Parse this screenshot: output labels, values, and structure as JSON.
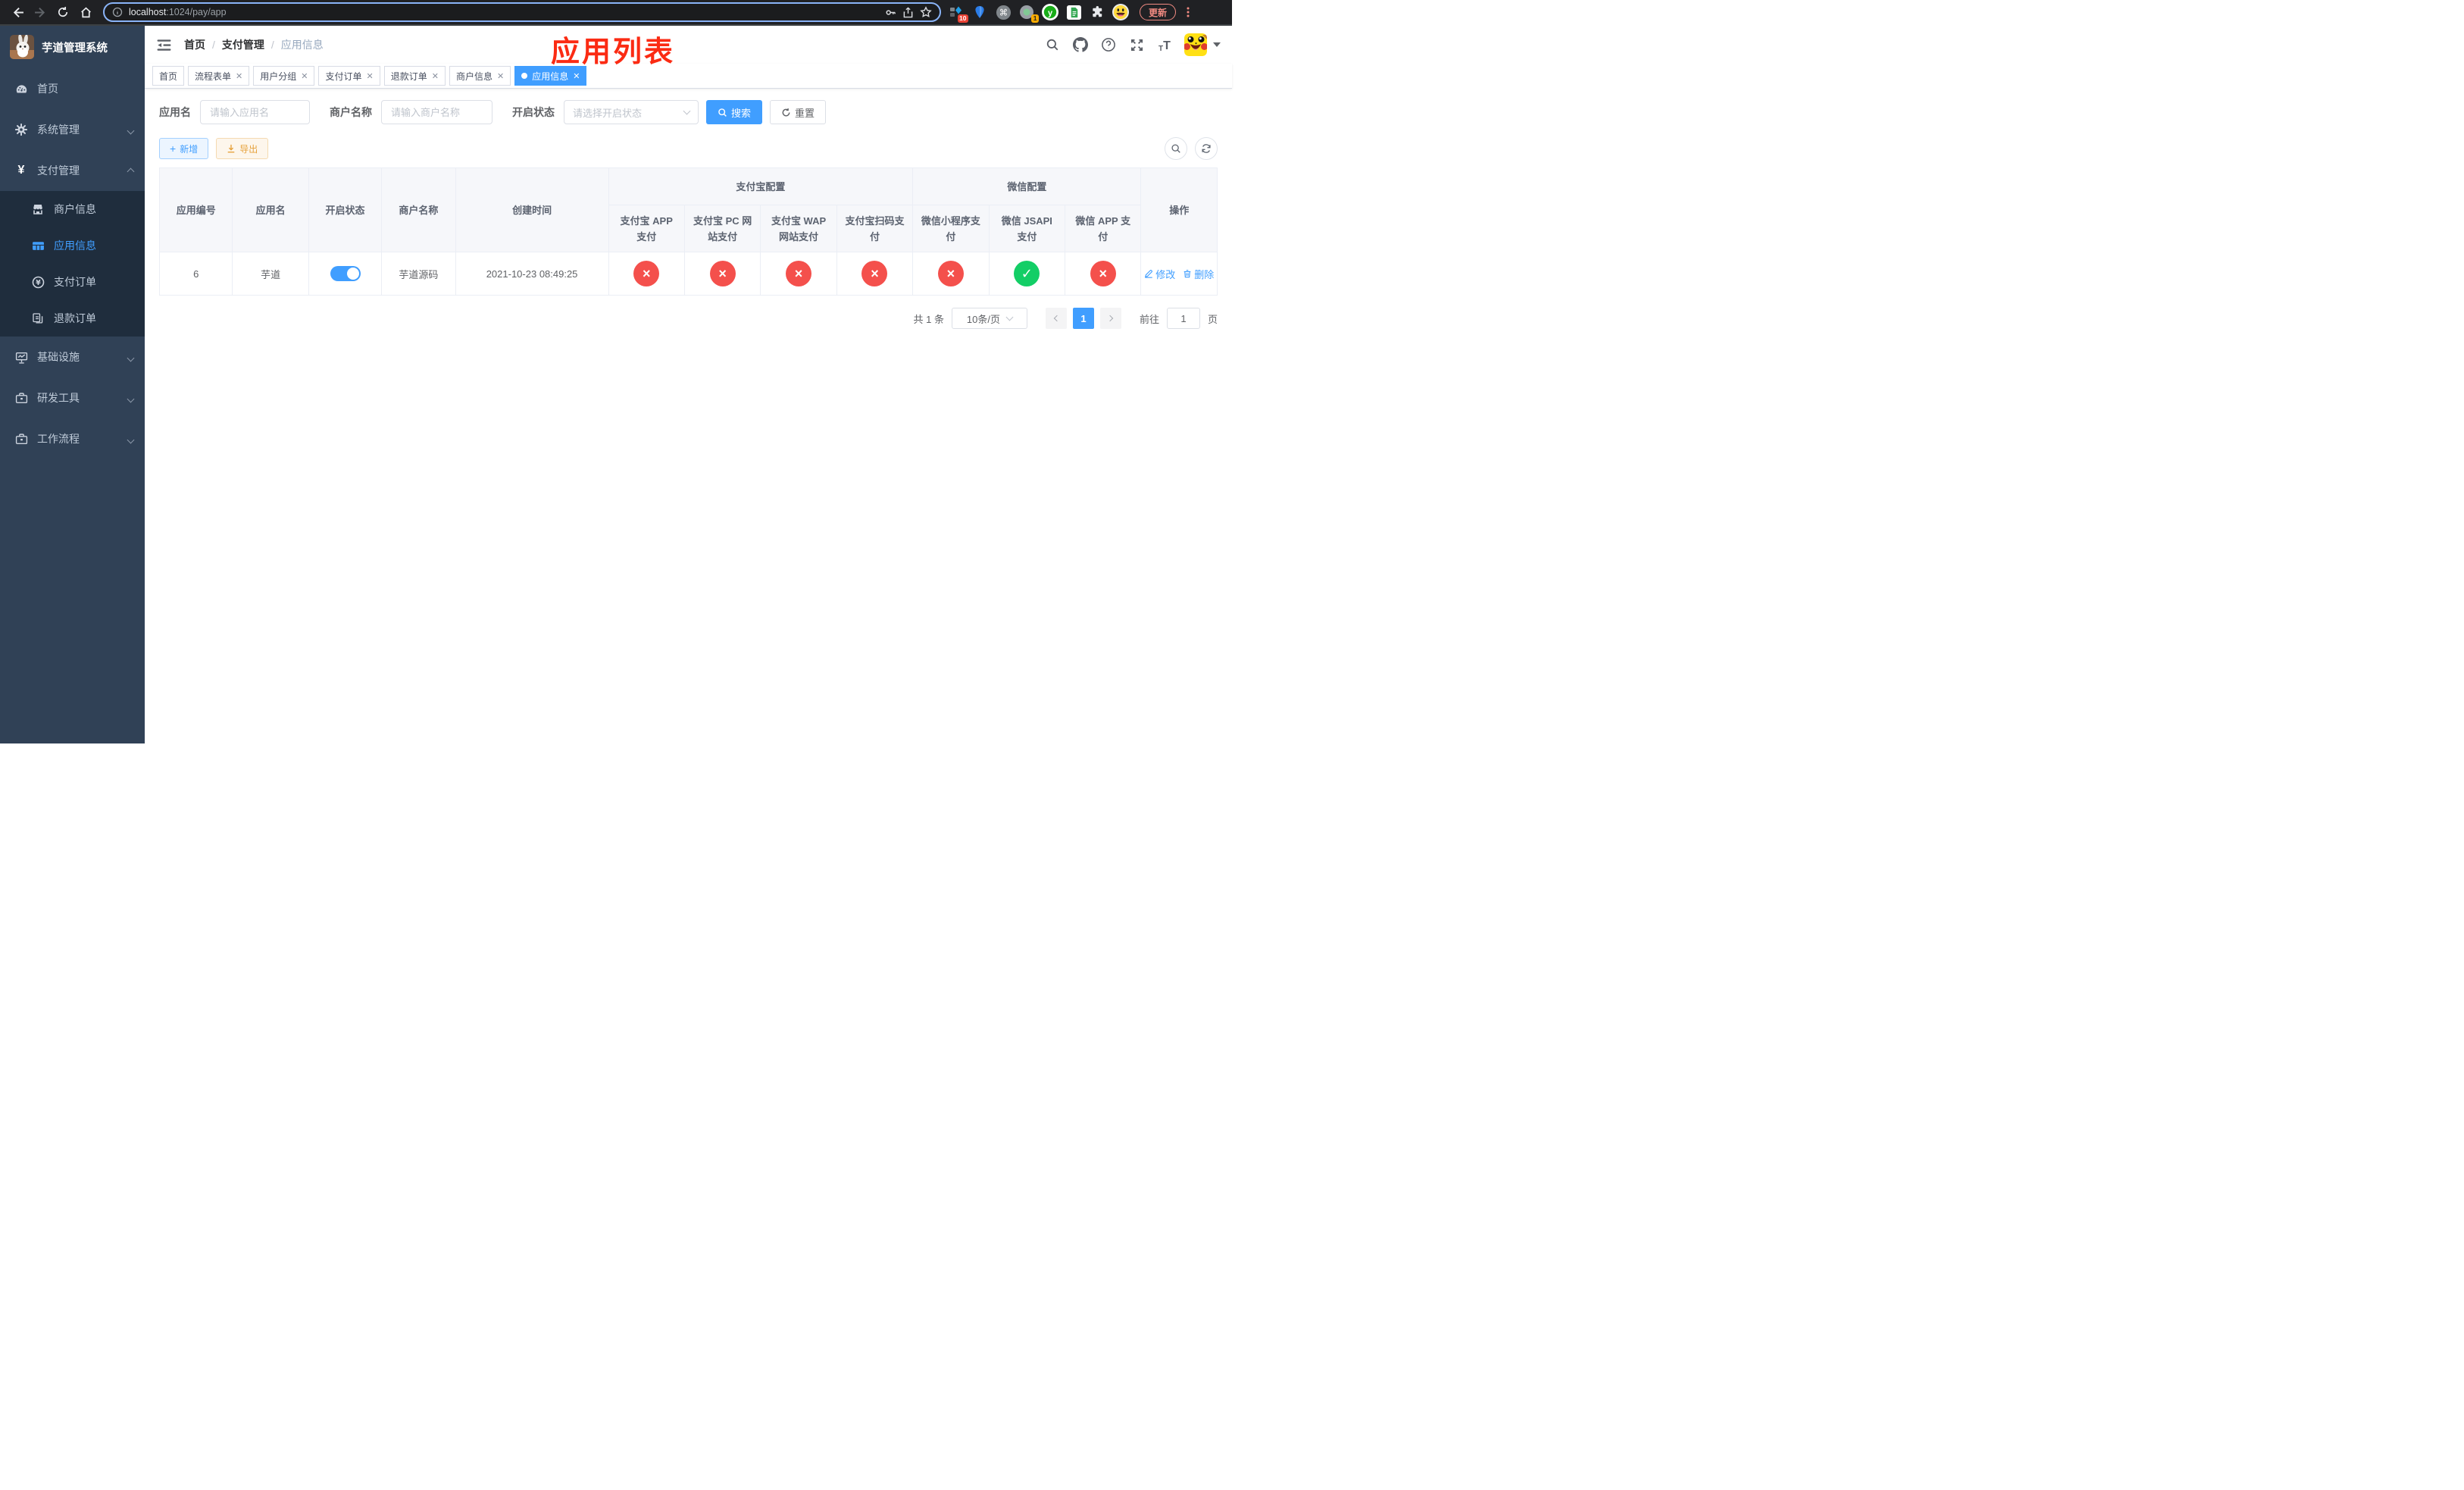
{
  "browser": {
    "url_host": "localhost",
    "url_path": ":1024/pay/app",
    "update_label": "更新",
    "extension_badge_a": "10",
    "extension_badge_b": "1"
  },
  "sidebar": {
    "title": "芋道管理系统",
    "menu": {
      "home": "首页",
      "system": "系统管理",
      "payment": "支付管理",
      "infra": "基础设施",
      "devtools": "研发工具",
      "workflow": "工作流程"
    },
    "submenu": {
      "merchant": "商户信息",
      "app": "应用信息",
      "pay_order": "支付订单",
      "refund_order": "退款订单"
    }
  },
  "navbar": {
    "breadcrumb": {
      "home": "首页",
      "section": "支付管理",
      "current": "应用信息"
    },
    "annotation": "应用列表"
  },
  "tabs": {
    "home": "首页",
    "flow_form": "流程表单",
    "user_group": "用户分组",
    "pay_order": "支付订单",
    "refund_order": "退款订单",
    "merchant": "商户信息",
    "app": "应用信息"
  },
  "filters": {
    "app_name_label": "应用名",
    "app_name_placeholder": "请输入应用名",
    "merchant_label": "商户名称",
    "merchant_placeholder": "请输入商户名称",
    "status_label": "开启状态",
    "status_placeholder": "请选择开启状态",
    "search_label": "搜索",
    "reset_label": "重置"
  },
  "toolbar": {
    "add_label": "新增",
    "export_label": "导出"
  },
  "table": {
    "headers": {
      "app_id": "应用编号",
      "app_name": "应用名",
      "status": "开启状态",
      "merchant_name": "商户名称",
      "create_time": "创建时间",
      "alipay_group": "支付宝配置",
      "wechat_group": "微信配置",
      "alipay_app": "支付宝 APP 支付",
      "alipay_pc": "支付宝 PC 网站支付",
      "alipay_wap": "支付宝 WAP 网站支付",
      "alipay_qr": "支付宝扫码支付",
      "wechat_lite": "微信小程序支付",
      "wechat_jsapi": "微信 JSAPI 支付",
      "wechat_app": "微信 APP 支付",
      "actions": "操作"
    },
    "row": {
      "app_id": "6",
      "app_name": "芋道",
      "status_enabled": true,
      "merchant_name": "芋道源码",
      "create_time": "2021-10-23 08:49:25",
      "channels": [
        {
          "key": "alipay_app",
          "enabled": false
        },
        {
          "key": "alipay_pc",
          "enabled": false
        },
        {
          "key": "alipay_wap",
          "enabled": false
        },
        {
          "key": "alipay_qr",
          "enabled": false
        },
        {
          "key": "wechat_lite",
          "enabled": false
        },
        {
          "key": "wechat_jsapi",
          "enabled": true
        },
        {
          "key": "wechat_app",
          "enabled": false
        }
      ],
      "edit_label": "修改",
      "delete_label": "删除"
    }
  },
  "pagination": {
    "total": "共 1 条",
    "page_size": "10条/页",
    "current_page": "1",
    "goto_label": "前往",
    "goto_value": "1",
    "goto_unit": "页"
  },
  "colors": {
    "primary": "#409eff",
    "success": "#13ce66",
    "danger": "#f4504c",
    "warning": "#e6a23c",
    "sidebar_bg": "#304156",
    "submenu_bg": "#1f2d3d",
    "annotation_red": "#fb2b13"
  }
}
